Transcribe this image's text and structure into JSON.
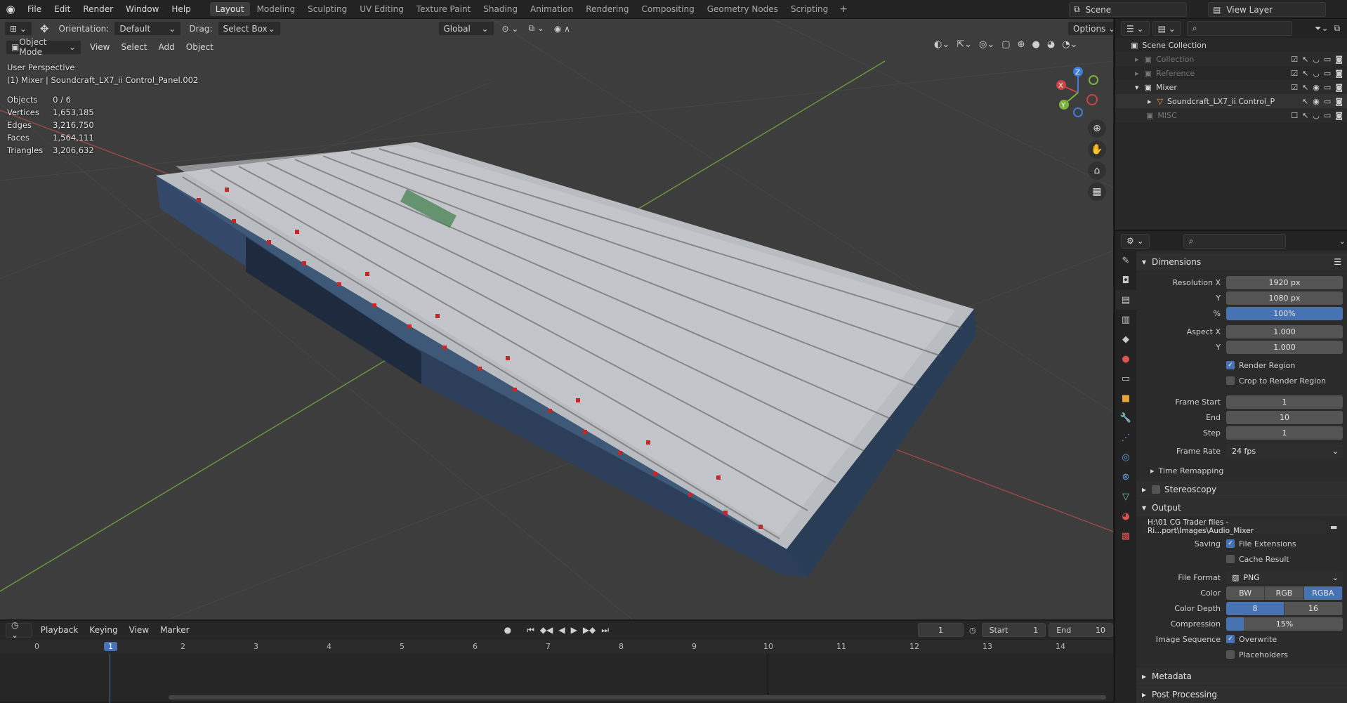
{
  "topbar": {
    "menus": [
      "File",
      "Edit",
      "Render",
      "Window",
      "Help"
    ],
    "workspaces": [
      "Layout",
      "Modeling",
      "Sculpting",
      "UV Editing",
      "Texture Paint",
      "Shading",
      "Animation",
      "Rendering",
      "Compositing",
      "Geometry Nodes",
      "Scripting"
    ],
    "active_workspace": "Layout",
    "scene": "Scene",
    "view_layer": "View Layer"
  },
  "viewport": {
    "orientation_label": "Orientation:",
    "orientation_value": "Default",
    "drag_label": "Drag:",
    "drag_value": "Select Box",
    "transform_orientation": "Global",
    "options": "Options",
    "mode": "Object Mode",
    "menus": [
      "View",
      "Select",
      "Add",
      "Object"
    ],
    "perspective": "User Perspective",
    "active_object": "(1) Mixer | Soundcraft_LX7_ii Control_Panel.002",
    "stats": [
      {
        "label": "Objects",
        "value": "0 / 6"
      },
      {
        "label": "Vertices",
        "value": "1,653,185"
      },
      {
        "label": "Edges",
        "value": "3,216,750"
      },
      {
        "label": "Faces",
        "value": "1,564,111"
      },
      {
        "label": "Triangles",
        "value": "3,206,632"
      }
    ],
    "gizmo": {
      "x": "X",
      "y": "Y",
      "z": "Z"
    }
  },
  "timeline": {
    "menus": [
      "Playback",
      "Keying",
      "View",
      "Marker"
    ],
    "current_frame": "1",
    "start_label": "Start",
    "start": "1",
    "end_label": "End",
    "end": "10",
    "ruler": [
      "0",
      "1",
      "2",
      "3",
      "4",
      "5",
      "6",
      "7",
      "8",
      "9",
      "10",
      "11",
      "12",
      "13",
      "14"
    ]
  },
  "outliner": {
    "root": "Scene Collection",
    "items": [
      {
        "name": "Collection",
        "muted": true
      },
      {
        "name": "Reference",
        "muted": true
      },
      {
        "name": "Mixer",
        "muted": false
      },
      {
        "name": "Soundcraft_LX7_ii Control_P",
        "muted": false
      },
      {
        "name": "MISC",
        "muted": true
      }
    ]
  },
  "properties": {
    "dimensions": {
      "title": "Dimensions",
      "res_x_label": "Resolution X",
      "res_x": "1920 px",
      "res_y_label": "Y",
      "res_y": "1080 px",
      "pct_label": "%",
      "pct": "100%",
      "aspect_x_label": "Aspect X",
      "aspect_x": "1.000",
      "aspect_y_label": "Y",
      "aspect_y": "1.000",
      "render_region": "Render Region",
      "crop_region": "Crop to Render Region",
      "frame_start_label": "Frame Start",
      "frame_start": "1",
      "end_label": "End",
      "end": "10",
      "step_label": "Step",
      "step": "1",
      "frame_rate_label": "Frame Rate",
      "frame_rate": "24 fps",
      "time_remapping": "Time Remapping"
    },
    "stereoscopy": "Stereoscopy",
    "output": {
      "title": "Output",
      "path": "H:\\01 CG Trader files - Ri...port\\Images\\Audio_Mixer",
      "saving_label": "Saving",
      "file_extensions": "File Extensions",
      "cache_result": "Cache Result",
      "file_format_label": "File Format",
      "file_format": "PNG",
      "color_label": "Color",
      "color_opts": [
        "BW",
        "RGB",
        "RGBA"
      ],
      "color_depth_label": "Color Depth",
      "depth_opts": [
        "8",
        "16"
      ],
      "compression_label": "Compression",
      "compression": "15%",
      "image_sequence_label": "Image Sequence",
      "overwrite": "Overwrite",
      "placeholders": "Placeholders"
    },
    "metadata": "Metadata",
    "post_processing": "Post Processing"
  }
}
